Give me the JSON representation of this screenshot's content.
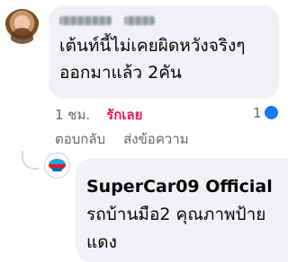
{
  "comment": {
    "text": "เต้นท์นี้ไม่เคยผิดหวังจริงๆ\nออกมาแล้ว 2คัน",
    "time": "1 ชม.",
    "reaction_label": "รักเลย",
    "reaction_count": "1"
  },
  "actions": {
    "reply": "ตอบกลับ",
    "message": "ส่งข้อความ"
  },
  "reply": {
    "name": "SuperCar09 Official",
    "text": " รถบ้านมือ2 คุณภาพป้ายแดง"
  },
  "colors": {
    "bubble": "#f0f2f5",
    "reaction": "#e31b5a",
    "reaction_icon": "#1877f2"
  }
}
